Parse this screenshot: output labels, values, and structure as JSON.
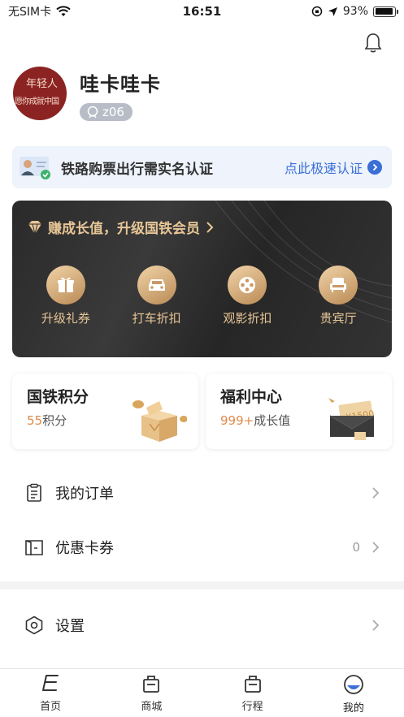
{
  "status_bar": {
    "carrier": "无SIM卡",
    "time": "16:51",
    "battery": "93%",
    "battery_level": 0.93
  },
  "profile": {
    "avatar_text_line1": "年轻人",
    "avatar_text_line2": "愿你成就中国",
    "username": "哇卡哇卡",
    "tag": "z06"
  },
  "verify_banner": {
    "text": "铁路购票出行需实名认证",
    "link": "点此极速认证"
  },
  "vip": {
    "header": "赚成长值，升级国铁会员",
    "items": [
      {
        "label": "升级礼券",
        "icon": "gift-icon"
      },
      {
        "label": "打车折扣",
        "icon": "car-icon"
      },
      {
        "label": "观影折扣",
        "icon": "film-reel-icon"
      },
      {
        "label": "贵宾厅",
        "icon": "armchair-icon"
      }
    ]
  },
  "cards": {
    "points": {
      "title": "国铁积分",
      "value": "55",
      "unit": "积分"
    },
    "welfare": {
      "title": "福利中心",
      "value": "999+",
      "unit": "成长值",
      "art_text": "¥1500"
    }
  },
  "menu": {
    "orders": {
      "label": "我的订单"
    },
    "coupons": {
      "label": "优惠卡券",
      "count": "0"
    },
    "settings": {
      "label": "设置"
    }
  },
  "tabbar": [
    {
      "label": "首页",
      "icon": "home-icon"
    },
    {
      "label": "商城",
      "icon": "shop-bag-icon"
    },
    {
      "label": "行程",
      "icon": "trip-bag-icon"
    },
    {
      "label": "我的",
      "icon": "profile-icon",
      "active": true
    }
  ],
  "colors": {
    "accent_blue": "#3a6fd8",
    "gold": "#e7c596",
    "orange": "#e08a4a",
    "avatar_red": "#8c2323"
  }
}
